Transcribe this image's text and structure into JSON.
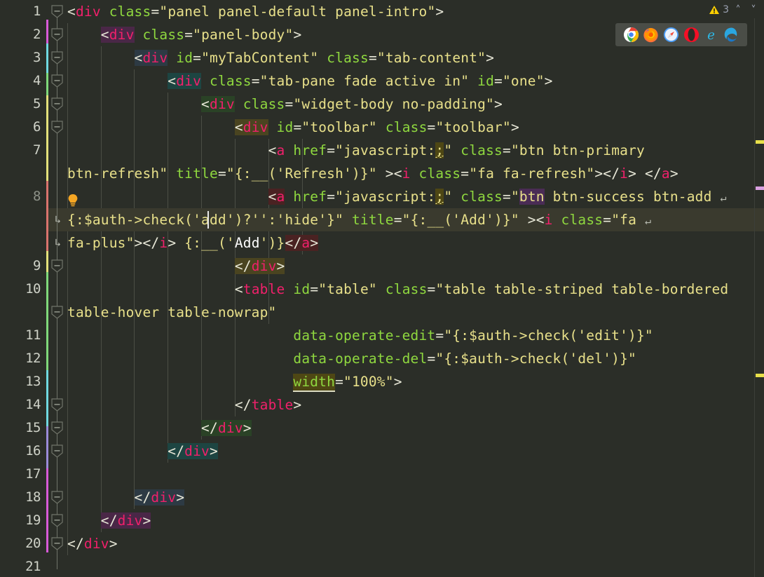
{
  "editor": {
    "language": "html",
    "warning_badge": {
      "icon": "warning-triangle-icon",
      "count": "3",
      "prev": "˄",
      "next": "˅"
    },
    "cursor": {
      "line": "8",
      "visual_row": "9"
    },
    "colors": {
      "background": "#2b2e28",
      "current_line": "#3a3a2e",
      "tag": "#f0206b",
      "attribute": "#8fd83f",
      "string": "#e8e08a",
      "punctuation": "#e8e8d8",
      "line_number": "#cfd2c8",
      "indent_guide": "#4b4e45",
      "warning": "#ffd000"
    },
    "gutter_numbers": [
      "1",
      "2",
      "3",
      "4",
      "5",
      "6",
      "7",
      "8",
      "9",
      "10",
      "11",
      "12",
      "13",
      "14",
      "15",
      "16",
      "17",
      "18",
      "19",
      "20",
      "21"
    ],
    "lines": [
      {
        "n": "1",
        "text": "<div class=\"panel panel-default panel-intro\">"
      },
      {
        "n": "2",
        "text": "    <div class=\"panel-body\">"
      },
      {
        "n": "3",
        "text": "        <div id=\"myTabContent\" class=\"tab-content\">"
      },
      {
        "n": "4",
        "text": "            <div class=\"tab-pane fade active in\" id=\"one\">"
      },
      {
        "n": "5",
        "text": "                <div class=\"widget-body no-padding\">"
      },
      {
        "n": "6",
        "text": "                    <div id=\"toolbar\" class=\"toolbar\">"
      },
      {
        "n": "7",
        "text": "                        <a href=\"javascript:;\" class=\"btn btn-primary btn-refresh\" title=\"{:__('Refresh')}\" ><i class=\"fa fa-refresh\"></i> </a>"
      },
      {
        "n": "8",
        "text": "                        <a href=\"javascript:;\" class=\"btn btn-success btn-add {:$auth->check('add')?'':'hide'}\" title=\"{:__('Add')}\" ><i class=\"fa fa-plus\"></i> {:__('Add')}</a>"
      },
      {
        "n": "9",
        "text": "                    </div>"
      },
      {
        "n": "10",
        "text": "                    <table id=\"table\" class=\"table table-striped table-bordered table-hover table-nowrap\""
      },
      {
        "n": "11",
        "text": "                           data-operate-edit=\"{:$auth->check('edit')}\""
      },
      {
        "n": "12",
        "text": "                           data-operate-del=\"{:$auth->check('del')}\""
      },
      {
        "n": "13",
        "text": "                           width=\"100%\">"
      },
      {
        "n": "14",
        "text": "                    </table>"
      },
      {
        "n": "15",
        "text": "                </div>"
      },
      {
        "n": "16",
        "text": "            </div>"
      },
      {
        "n": "17",
        "text": ""
      },
      {
        "n": "18",
        "text": "        </div>"
      },
      {
        "n": "19",
        "text": "    </div>"
      },
      {
        "n": "20",
        "text": "</div>"
      },
      {
        "n": "21",
        "text": ""
      }
    ]
  },
  "browser_bar": {
    "icons": [
      "chrome-icon",
      "firefox-icon",
      "safari-icon",
      "opera-icon",
      "internet-explorer-icon",
      "edge-icon"
    ]
  },
  "overview_ruler": {
    "markers": [
      {
        "name": "warning-marker",
        "color": "#e8e04a",
        "top": "200"
      },
      {
        "name": "selection-marker",
        "color": "#d9a0e0",
        "top": "266"
      },
      {
        "name": "warning-marker",
        "color": "#e8e04a",
        "top": "533"
      }
    ]
  }
}
